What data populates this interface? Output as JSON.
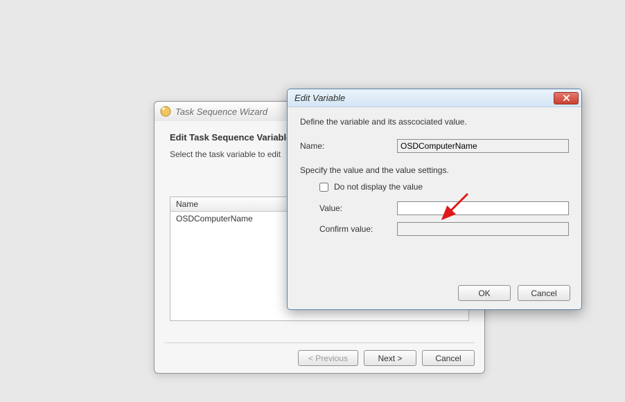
{
  "wizard": {
    "title": "Task Sequence Wizard",
    "heading": "Edit Task Sequence Variables",
    "subheading": "Select the task variable to edit",
    "table": {
      "header_name": "Name",
      "rows": [
        {
          "name": "OSDComputerName"
        }
      ]
    },
    "buttons": {
      "previous": "< Previous",
      "next": "Next >",
      "cancel": "Cancel"
    }
  },
  "dialog": {
    "title": "Edit Variable",
    "description": "Define the variable and its asscociated value.",
    "name_label": "Name:",
    "name_value": "OSDComputerName",
    "value_section_heading": "Specify the value and the value settings.",
    "do_not_display_label": "Do not display the value",
    "do_not_display_checked": false,
    "value_label": "Value:",
    "value_value": "",
    "confirm_label": "Confirm value:",
    "confirm_value": "",
    "buttons": {
      "ok": "OK",
      "cancel": "Cancel"
    }
  }
}
